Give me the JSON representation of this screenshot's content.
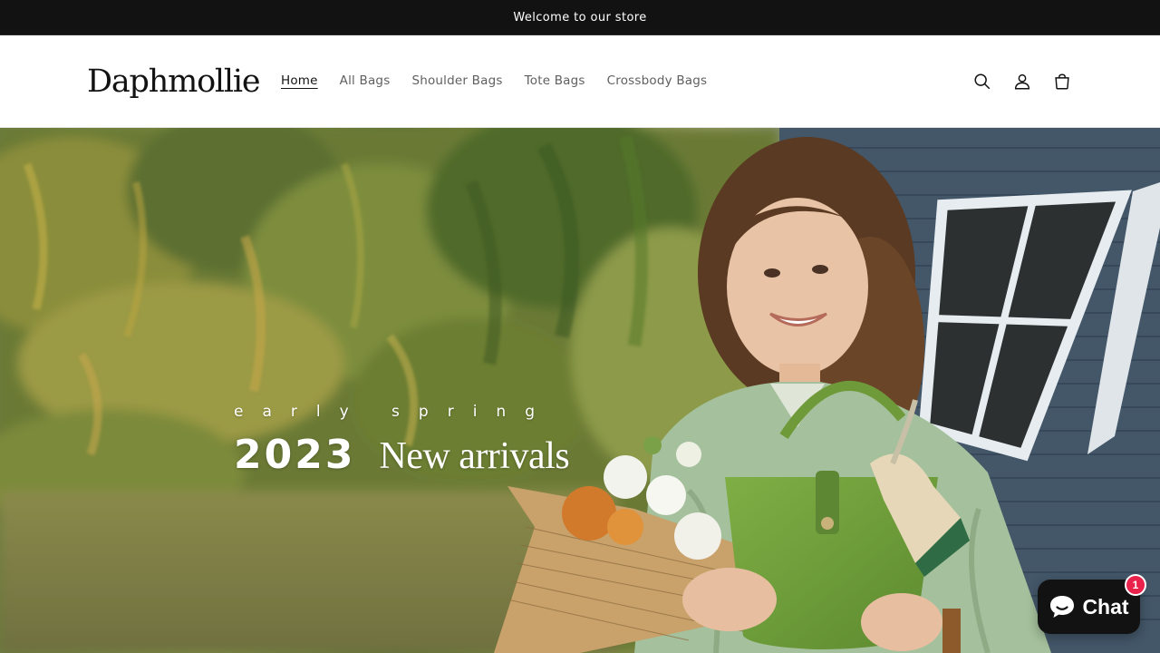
{
  "announcement": {
    "text": "Welcome to our store"
  },
  "header": {
    "logo": "Daphmollie",
    "nav": [
      {
        "label": "Home",
        "active": true
      },
      {
        "label": "All Bags",
        "active": false
      },
      {
        "label": "Shoulder Bags",
        "active": false
      },
      {
        "label": "Tote Bags",
        "active": false
      },
      {
        "label": "Crossbody Bags",
        "active": false
      }
    ],
    "icons": [
      "search-icon",
      "account-icon",
      "cart-icon"
    ]
  },
  "hero": {
    "kicker": "early spring",
    "year": "2023",
    "title": "New arrivals"
  },
  "chat": {
    "label": "Chat",
    "badge_count": "1",
    "icon": "chat-bubble-icon",
    "badge_color": "#e8224b"
  },
  "colors": {
    "announcement_bg": "#121212",
    "header_bg": "#ffffff",
    "nav_text": "#5f5f5f",
    "nav_active": "#121212",
    "bag_green": "#6f9a3a",
    "shirt_green": "#a9c3a0",
    "siding_blue": "#45596b"
  }
}
